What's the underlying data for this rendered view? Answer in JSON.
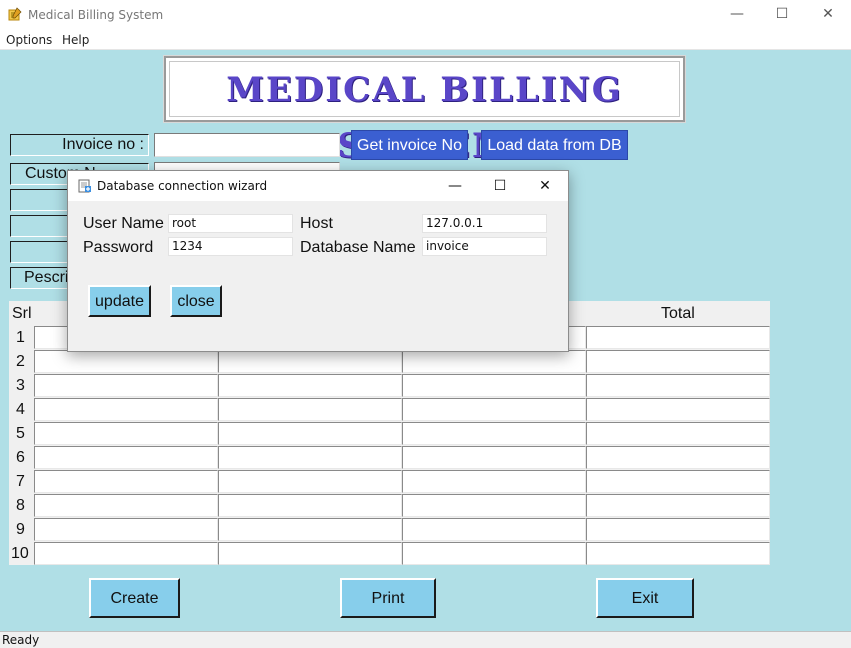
{
  "window": {
    "title": "Medical Billing System",
    "minimize": "—",
    "maximize": "☐",
    "close": "✕"
  },
  "menu": [
    "Options",
    "Help"
  ],
  "banner": {
    "text": "MEDICAL BILLING SYSTEM"
  },
  "form": {
    "invoice_label": "Invoice no :",
    "customer_label": "Custom",
    "customer_label_tail": "N",
    "prescription_label": "Pescri",
    "get_invoice_button": "Get invoice No",
    "load_data_button": "Load data from DB"
  },
  "table": {
    "headers": {
      "srl": "Srl",
      "total": "Total"
    },
    "rows": [
      "1",
      "2",
      "3",
      "4",
      "5",
      "6",
      "7",
      "8",
      "9",
      "10"
    ]
  },
  "actions": {
    "create": "Create",
    "print": "Print",
    "exit": "Exit"
  },
  "status": {
    "text": "Ready"
  },
  "dialog": {
    "title": "Database connection wizard",
    "user_name_label": "User Name",
    "user_name_value": "root",
    "password_label": "Password",
    "password_value": "1234",
    "host_label": "Host",
    "host_value": "127.0.0.1",
    "database_label": "Database Name",
    "database_value": "invoice",
    "update_button": "update",
    "close_button": "close",
    "minimize": "—",
    "maximize": "☐",
    "close": "✕"
  },
  "colors": {
    "background": "#b0dfe6",
    "banner_text": "#5a46c8",
    "blue_button": "#3b5fd1",
    "action_button": "#87ceeb"
  }
}
